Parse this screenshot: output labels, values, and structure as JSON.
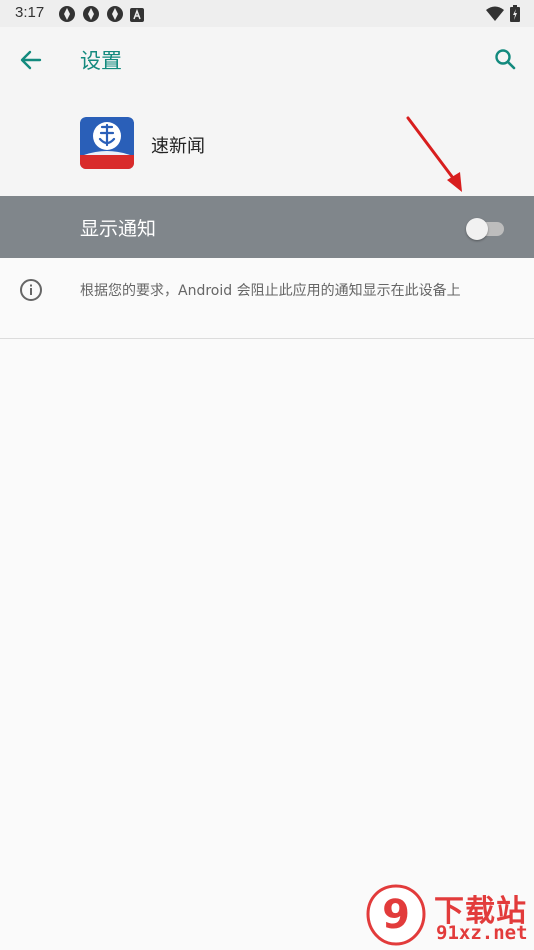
{
  "status_bar": {
    "time": "3:17",
    "notification_icons": [
      "sync-icon",
      "sync-icon",
      "sync-icon",
      "a-icon"
    ],
    "system_icons": [
      "wifi-icon",
      "battery-icon"
    ]
  },
  "app_bar": {
    "title": "设置",
    "back_icon": "arrow-left-icon",
    "search_icon": "search-icon",
    "accent_color": "#138a7e"
  },
  "app_header": {
    "app_name": "速新闻",
    "app_icon": "app-logo-icon"
  },
  "notification_toggle": {
    "label": "显示通知",
    "enabled": false
  },
  "info": {
    "icon": "info-icon",
    "text": "根据您的要求，Android 会阻止此应用的通知显示在此设备上"
  },
  "watermark": {
    "badge_text": "9",
    "title": "下载站",
    "url": "91xz.net"
  },
  "colors": {
    "toggle_row_bg": "#80868b",
    "arrow": "#d81e1e"
  }
}
